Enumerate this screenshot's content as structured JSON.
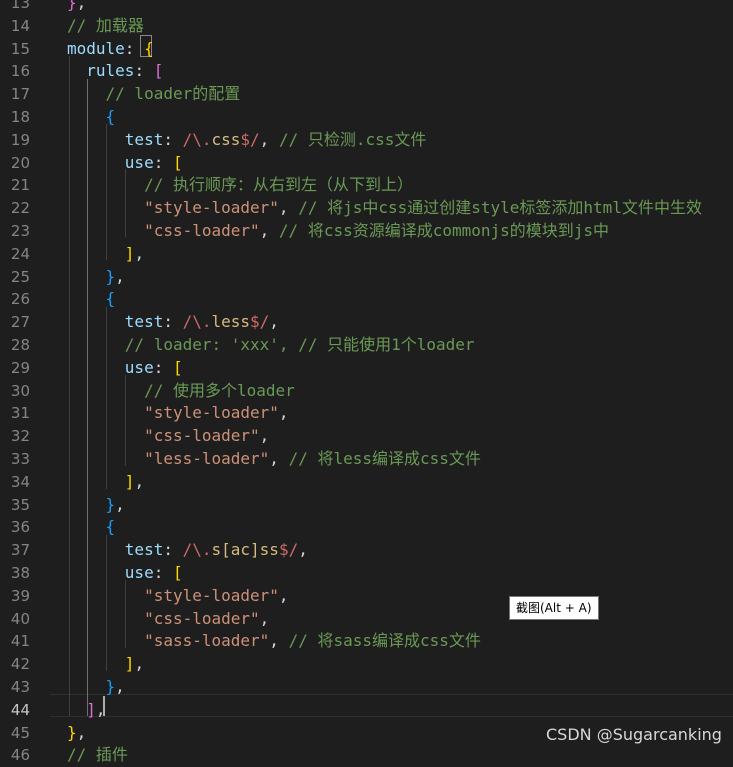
{
  "lines": [
    {
      "n": "13",
      "t": [
        [
          "b2",
          "}"
        ],
        [
          "plain",
          ","
        ]
      ]
    },
    {
      "n": "14",
      "t": [
        [
          "comment",
          "// 加载器"
        ]
      ]
    },
    {
      "n": "15",
      "t": [
        [
          "prop",
          "module"
        ],
        [
          "plain",
          ": "
        ],
        [
          "b1",
          "{"
        ]
      ]
    },
    {
      "n": "16",
      "t": [
        [
          "plain",
          "  "
        ],
        [
          "prop",
          "rules"
        ],
        [
          "plain",
          ": "
        ],
        [
          "b2",
          "["
        ]
      ]
    },
    {
      "n": "17",
      "t": [
        [
          "plain",
          "    "
        ],
        [
          "comment",
          "// loader的配置"
        ]
      ]
    },
    {
      "n": "18",
      "t": [
        [
          "plain",
          "    "
        ],
        [
          "b3",
          "{"
        ]
      ]
    },
    {
      "n": "19",
      "t": [
        [
          "plain",
          "      "
        ],
        [
          "prop",
          "test"
        ],
        [
          "plain",
          ": "
        ],
        [
          "regex",
          "/\\."
        ],
        [
          "regex-body",
          "css"
        ],
        [
          "regex",
          "$/"
        ],
        [
          "plain",
          ", "
        ],
        [
          "comment",
          "// 只检测.css文件"
        ]
      ]
    },
    {
      "n": "20",
      "t": [
        [
          "plain",
          "      "
        ],
        [
          "prop",
          "use"
        ],
        [
          "plain",
          ": "
        ],
        [
          "b1",
          "["
        ]
      ]
    },
    {
      "n": "21",
      "t": [
        [
          "plain",
          "        "
        ],
        [
          "comment",
          "// 执行顺序：从右到左（从下到上）"
        ]
      ]
    },
    {
      "n": "22",
      "t": [
        [
          "plain",
          "        "
        ],
        [
          "str",
          "\"style-loader\""
        ],
        [
          "plain",
          ", "
        ],
        [
          "comment",
          "// 将js中css通过创建style标签添加html文件中生效"
        ]
      ]
    },
    {
      "n": "23",
      "t": [
        [
          "plain",
          "        "
        ],
        [
          "str",
          "\"css-loader\""
        ],
        [
          "plain",
          ", "
        ],
        [
          "comment",
          "// 将css资源编译成commonjs的模块到js中"
        ]
      ]
    },
    {
      "n": "24",
      "t": [
        [
          "plain",
          "      "
        ],
        [
          "b1",
          "]"
        ],
        [
          "plain",
          ","
        ]
      ]
    },
    {
      "n": "25",
      "t": [
        [
          "plain",
          "    "
        ],
        [
          "b3",
          "}"
        ],
        [
          "plain",
          ","
        ]
      ]
    },
    {
      "n": "26",
      "t": [
        [
          "plain",
          "    "
        ],
        [
          "b3",
          "{"
        ]
      ]
    },
    {
      "n": "27",
      "t": [
        [
          "plain",
          "      "
        ],
        [
          "prop",
          "test"
        ],
        [
          "plain",
          ": "
        ],
        [
          "regex",
          "/\\."
        ],
        [
          "regex-body",
          "less"
        ],
        [
          "regex",
          "$/"
        ],
        [
          "plain",
          ","
        ]
      ]
    },
    {
      "n": "28",
      "t": [
        [
          "plain",
          "      "
        ],
        [
          "comment",
          "// loader: 'xxx', // 只能使用1个loader"
        ]
      ]
    },
    {
      "n": "29",
      "t": [
        [
          "plain",
          "      "
        ],
        [
          "prop",
          "use"
        ],
        [
          "plain",
          ": "
        ],
        [
          "b1",
          "["
        ]
      ]
    },
    {
      "n": "30",
      "t": [
        [
          "plain",
          "        "
        ],
        [
          "comment",
          "// 使用多个loader"
        ]
      ]
    },
    {
      "n": "31",
      "t": [
        [
          "plain",
          "        "
        ],
        [
          "str",
          "\"style-loader\""
        ],
        [
          "plain",
          ","
        ]
      ]
    },
    {
      "n": "32",
      "t": [
        [
          "plain",
          "        "
        ],
        [
          "str",
          "\"css-loader\""
        ],
        [
          "plain",
          ","
        ]
      ]
    },
    {
      "n": "33",
      "t": [
        [
          "plain",
          "        "
        ],
        [
          "str",
          "\"less-loader\""
        ],
        [
          "plain",
          ", "
        ],
        [
          "comment",
          "// 将less编译成css文件"
        ]
      ]
    },
    {
      "n": "34",
      "t": [
        [
          "plain",
          "      "
        ],
        [
          "b1",
          "]"
        ],
        [
          "plain",
          ","
        ]
      ]
    },
    {
      "n": "35",
      "t": [
        [
          "plain",
          "    "
        ],
        [
          "b3",
          "}"
        ],
        [
          "plain",
          ","
        ]
      ]
    },
    {
      "n": "36",
      "t": [
        [
          "plain",
          "    "
        ],
        [
          "b3",
          "{"
        ]
      ]
    },
    {
      "n": "37",
      "t": [
        [
          "plain",
          "      "
        ],
        [
          "prop",
          "test"
        ],
        [
          "plain",
          ": "
        ],
        [
          "regex",
          "/\\."
        ],
        [
          "regex-body",
          "s[ac]ss"
        ],
        [
          "regex",
          "$/"
        ],
        [
          "plain",
          ","
        ]
      ]
    },
    {
      "n": "38",
      "t": [
        [
          "plain",
          "      "
        ],
        [
          "prop",
          "use"
        ],
        [
          "plain",
          ": "
        ],
        [
          "b1",
          "["
        ]
      ]
    },
    {
      "n": "39",
      "t": [
        [
          "plain",
          "        "
        ],
        [
          "str",
          "\"style-loader\""
        ],
        [
          "plain",
          ","
        ]
      ]
    },
    {
      "n": "40",
      "t": [
        [
          "plain",
          "        "
        ],
        [
          "str",
          "\"css-loader\""
        ],
        [
          "plain",
          ","
        ]
      ]
    },
    {
      "n": "41",
      "t": [
        [
          "plain",
          "        "
        ],
        [
          "str",
          "\"sass-loader\""
        ],
        [
          "plain",
          ", "
        ],
        [
          "comment",
          "// 将sass编译成css文件"
        ]
      ]
    },
    {
      "n": "42",
      "t": [
        [
          "plain",
          "      "
        ],
        [
          "b1",
          "]"
        ],
        [
          "plain",
          ","
        ]
      ]
    },
    {
      "n": "43",
      "t": [
        [
          "plain",
          "    "
        ],
        [
          "b3",
          "}"
        ],
        [
          "plain",
          ","
        ]
      ]
    },
    {
      "n": "44",
      "t": [
        [
          "plain",
          "  "
        ],
        [
          "b2",
          "]"
        ],
        [
          "plain",
          ","
        ]
      ]
    },
    {
      "n": "45",
      "t": [
        [
          "b1",
          "}"
        ],
        [
          "plain",
          ","
        ]
      ]
    },
    {
      "n": "46",
      "t": [
        [
          "comment",
          "// 插件"
        ]
      ]
    }
  ],
  "active_line": "44",
  "tooltip": "截图(Alt + A)",
  "watermark": "CSDN @Sugarcanking"
}
